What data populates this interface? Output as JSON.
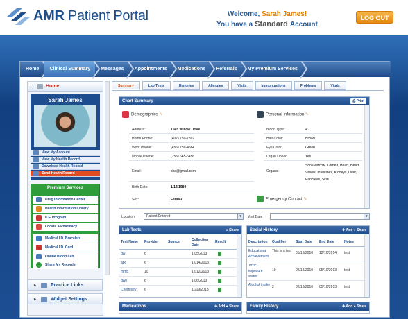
{
  "header": {
    "brand_prefix": "AMR",
    "brand_suffix": "Patient Portal",
    "welcome_text": "Welcome, ",
    "user_name": "Sarah James!",
    "account_prefix": "You have a",
    "account_type": "Standard",
    "account_suffix": "Account",
    "logout_label": "LOG OUT"
  },
  "nav": {
    "items": [
      {
        "label": "Home"
      },
      {
        "label": "Clinical Summary"
      },
      {
        "label": "Messages"
      },
      {
        "label": "Appointments"
      },
      {
        "label": "Medications"
      },
      {
        "label": "Referrals"
      },
      {
        "label": "My Premium Services"
      }
    ]
  },
  "sidebar": {
    "home_label": "Home",
    "profile_name": "Sarah James",
    "profile_links": [
      {
        "label": "View My Account"
      },
      {
        "label": "View My Health Record"
      },
      {
        "label": "Download Health Record"
      },
      {
        "label": "Send Health Record"
      }
    ],
    "premium_title": "Premium Services",
    "premium_links": [
      {
        "label": "Drug Information Center",
        "color": "#4a78b6"
      },
      {
        "label": "Health Information Library",
        "color": "#e08a1e"
      },
      {
        "label": "ICE Program",
        "color": "#c33"
      },
      {
        "label": "Locate A Pharmacy",
        "color": "#d44"
      },
      {
        "label": "Medical I.D. Bracelets",
        "color": "#3c7fc0"
      },
      {
        "label": "Medical I.D. Card",
        "color": "#c33"
      },
      {
        "label": "Online Blood Lab",
        "color": "#4a78b6"
      },
      {
        "label": "Share My Records",
        "color": "#2e9d3a"
      }
    ],
    "practice_links": "Practice Links",
    "widget_settings": "Widget Settings"
  },
  "tabs": [
    {
      "label": "Summary"
    },
    {
      "label": "Lab Tests"
    },
    {
      "label": "Histories"
    },
    {
      "label": "Allergies"
    },
    {
      "label": "Visits"
    },
    {
      "label": "Immunizations"
    },
    {
      "label": "Problems"
    },
    {
      "label": "Vitals"
    }
  ],
  "chart_summary": {
    "title": "Chart Summary",
    "print_label": "Print",
    "demographics_label": "Demographics",
    "personal_label": "Personal Information",
    "emergency_label": "Emergency Contact",
    "left": [
      {
        "label": "Address:",
        "value": "1045 Willow Drive"
      },
      {
        "label": "Home Phone:",
        "value": "(407) 789-7897"
      },
      {
        "label": "Work Phone:",
        "value": "(456) 789-4564"
      },
      {
        "label": "Mobile Phone:",
        "value": "(755) 645-6456"
      },
      {
        "label": "Email:",
        "value": "sha@gmail.com"
      },
      {
        "label": "Birth Date:",
        "value": "1/13/1989"
      },
      {
        "label": "Sex:",
        "value": "Female"
      }
    ],
    "right": [
      {
        "label": "Blood Type:",
        "value": "A -"
      },
      {
        "label": "Hair Color:",
        "value": "Brown"
      },
      {
        "label": "Eye Color:",
        "value": "Green"
      },
      {
        "label": "Organ Donor:",
        "value": "Yes"
      },
      {
        "label": "Organs:",
        "value": "SoneMarrow, Cornea, Heart, Heart Valves, Intestines, Kidneys, Liver, Pancreas, Skin"
      }
    ]
  },
  "filters": {
    "location_label": "Location",
    "location_value": "Patient Entered",
    "visit_label": "Visit Date",
    "visit_value": ""
  },
  "lab_tests": {
    "title": "Lab Tests",
    "share_label": "Share",
    "columns": [
      "Test Name",
      "Provider",
      "Source",
      "Collection Date",
      "Result"
    ],
    "rows": [
      {
        "name": "qw",
        "provider": "6",
        "date": "12/5/2013"
      },
      {
        "name": "abc",
        "provider": "6",
        "date": "12/14/2013"
      },
      {
        "name": "mmb",
        "provider": "10",
        "date": "12/12/2013"
      },
      {
        "name": "qwe",
        "provider": "6",
        "date": "12/6/2013"
      },
      {
        "name": "Chemistry",
        "provider": "6",
        "date": "11/19/2013"
      }
    ]
  },
  "social_history": {
    "title": "Social History",
    "add_label": "Add",
    "share_label": "Share",
    "columns": [
      "Description",
      "Qualifier",
      "Start Date",
      "End Date",
      "Notes"
    ],
    "rows": [
      {
        "description": "Educational Achievement",
        "qualifier": "This is a test",
        "start": "05/13/2010",
        "end": "12/10/2014",
        "notes": "test"
      },
      {
        "description": "Toxic exposure status",
        "qualifier": "10",
        "start": "02/13/2010",
        "end": "05/10/2013",
        "notes": "test"
      },
      {
        "description": "Alcohol intake",
        "qualifier": "2",
        "start": "02/13/2010",
        "end": "05/10/2013",
        "notes": "test"
      }
    ]
  },
  "bottom_panels": {
    "medications": "Medications",
    "family_history": "Family History",
    "add_label": "Add",
    "share_label": "Share"
  }
}
